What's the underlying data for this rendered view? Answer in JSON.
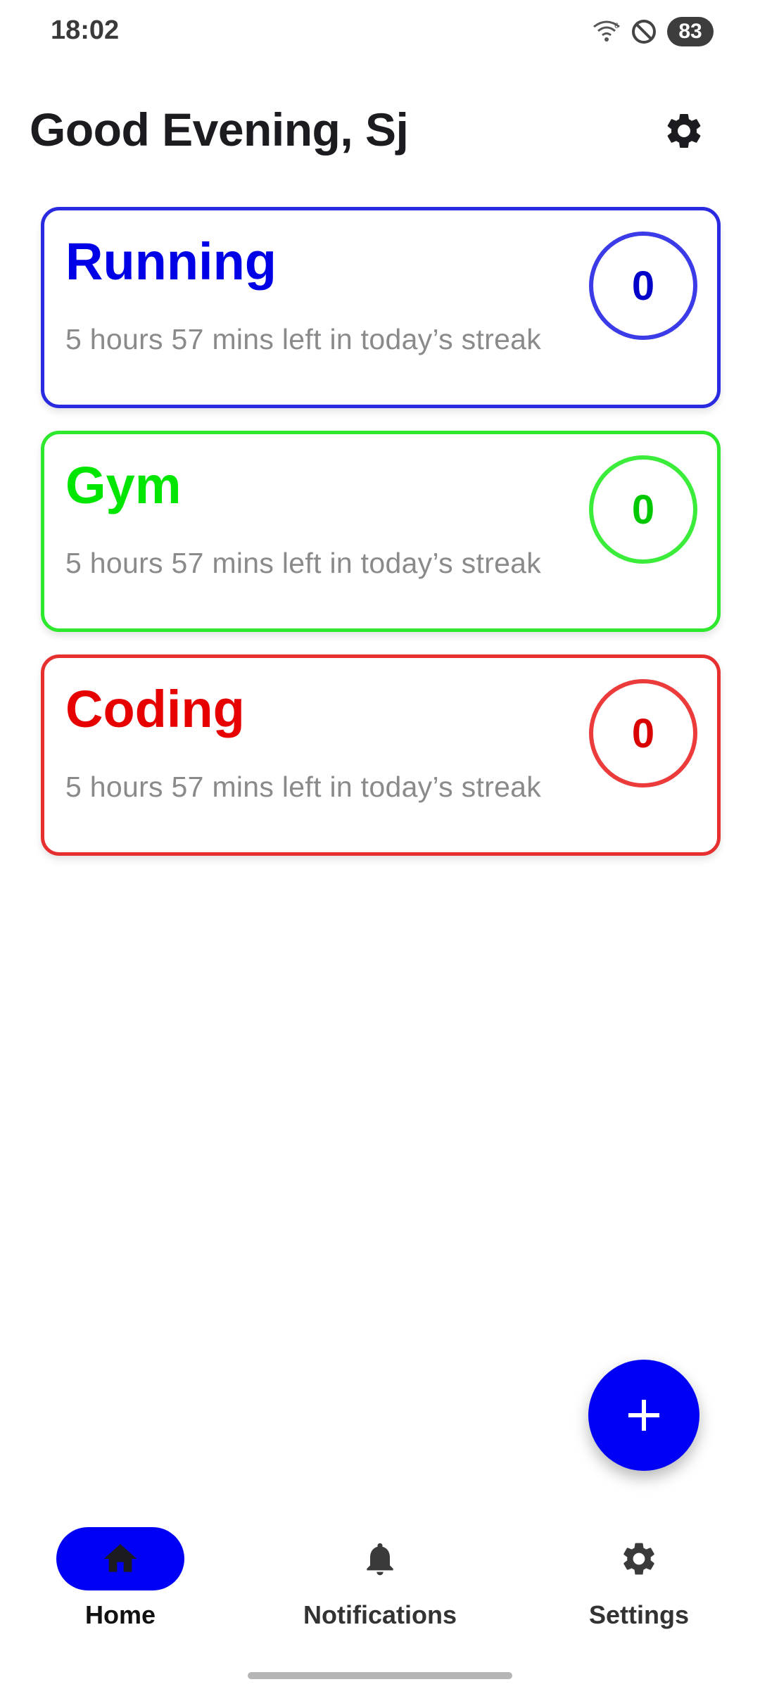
{
  "status_bar": {
    "time": "18:02",
    "battery": "83",
    "icons": [
      "wifi-icon",
      "do-not-disturb-icon"
    ]
  },
  "header": {
    "greeting": "Good Evening, Sj",
    "settings_icon": "gear-icon"
  },
  "habits": [
    {
      "name": "Running",
      "subtitle": "5 hours 57 mins left in today’s streak",
      "streak": "0",
      "color": "#0000e6"
    },
    {
      "name": "Gym",
      "subtitle": "5 hours 57 mins left in today’s streak",
      "streak": "0",
      "color": "#00e600"
    },
    {
      "name": "Coding",
      "subtitle": "5 hours 57 mins left in today’s streak",
      "streak": "0",
      "color": "#e60000"
    }
  ],
  "fab": {
    "icon": "plus-icon",
    "color": "#0000f5"
  },
  "bottom_nav": {
    "items": [
      {
        "label": "Home",
        "icon": "home-icon",
        "selected": true
      },
      {
        "label": "Notifications",
        "icon": "bell-icon",
        "selected": false
      },
      {
        "label": "Settings",
        "icon": "gear-icon",
        "selected": false
      }
    ]
  },
  "colors": {
    "accent": "#0000f5",
    "text_primary": "#1c1b1f",
    "text_secondary": "#8a8a8a"
  }
}
